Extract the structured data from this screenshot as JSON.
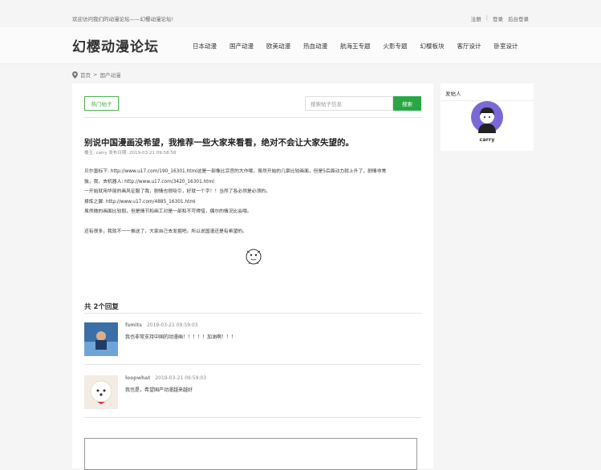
{
  "topbar": {
    "welcome": "欢迎访问我们的动漫论坛——幻樱动漫论坛!",
    "register": "注册",
    "separator": "|",
    "login": "登录",
    "admin_login": "后台登录"
  },
  "header": {
    "logo": "幻樱动漫论坛",
    "nav": [
      "日本动漫",
      "国产动漫",
      "欧美动漫",
      "热血动漫",
      "航海王专题",
      "火影专题",
      "幻樱板块",
      "客厅设计",
      "卧室设计"
    ]
  },
  "breadcrumb": {
    "home": "首页",
    "sep": ">",
    "current": "国产动漫"
  },
  "toolbar": {
    "hot_label": "热门帖子",
    "search_placeholder": "搜索帖子信息",
    "search_button": "搜索"
  },
  "post": {
    "title": "别说中国漫画没希望，我推荐一些大家来看看，绝对不会让大家失望的。",
    "meta": "楼主: carry   发布日期: 2019-03-21 09:58:58",
    "lines": [
      "       贝尔墨标下: http://www.u17.com/190_16301.html这是一部像比凉宫的大作哦，虽然开始的几章比较画面，但是5后面动力就上升了，剧情非常",
      "独，我，去机器人: http://www.u17.com/3420_16301.html",
      "一开始就用华丽的画风征服了我，剧情也很吸引，好就一个字！！当然了各必然是必须的。",
      "择炼之翼: http://www.u17.com/4885_16301.html",
      "虽然微的画面比较弱，但是情节和画工对是一部和不可得惜，偶尔的情况比会哦。",
      "",
      "还有很多，我就不一一推送了，大家自己去发掘吧。所以说国漫还是有希望的。"
    ]
  },
  "replies": {
    "count_label": "共 2个回复",
    "items": [
      {
        "user": "fsmits",
        "time": "2019-03-21 09:59:03",
        "text": "我也非常支持中国的动漫画！！！！！加油啊！！！"
      },
      {
        "user": "loopwhat",
        "time": "2019-03-21 09:59:03",
        "text": "我也是，希望国产动漫越来越好"
      }
    ]
  },
  "sidebar": {
    "title": "发帖人",
    "username": "carry"
  },
  "colors": {
    "accent_green": "#28a745",
    "avatar_purple": "#7b68d6"
  }
}
